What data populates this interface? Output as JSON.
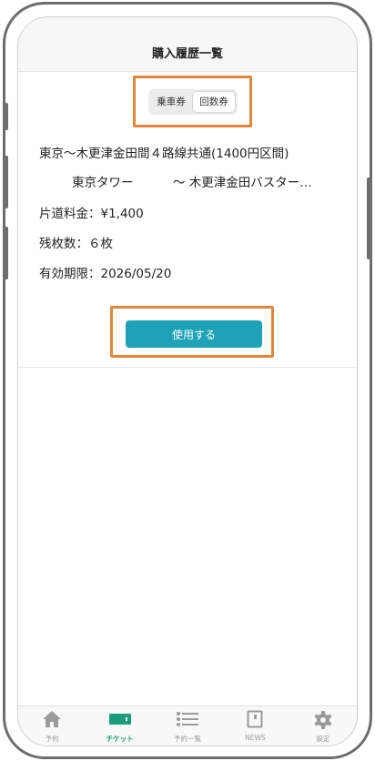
{
  "header": {
    "title": "購入履歴一覧"
  },
  "segment": {
    "items": [
      "乗車券",
      "回数券"
    ],
    "selected_index": 1
  },
  "ticket": {
    "name": "東京〜木更津金田間４路線共通(1400円区間)",
    "route_from": "東京タワー",
    "route_to": "〜 木更津金田バスター…",
    "fare": "片道料金：¥1,400",
    "remaining": "残枚数：６枚",
    "expiry": "有効期限：2026/05/20",
    "use_label": "使用する"
  },
  "tabbar": {
    "items": [
      {
        "label": "予約",
        "icon": "home-icon"
      },
      {
        "label": "チケット",
        "icon": "ticket-icon"
      },
      {
        "label": "予約一覧",
        "icon": "list-icon"
      },
      {
        "label": "NEWS",
        "icon": "news-icon"
      },
      {
        "label": "設定",
        "icon": "gear-icon"
      }
    ],
    "active_index": 1
  },
  "colors": {
    "accent": "#1ea2b7",
    "tab_active": "#1a9e7a",
    "highlight": "#e0873a"
  }
}
